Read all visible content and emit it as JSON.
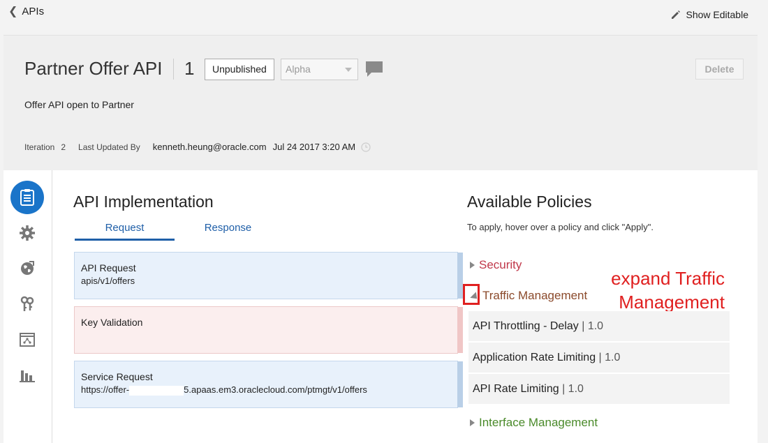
{
  "nav": {
    "back_label": "APIs",
    "show_editable_label": "Show Editable"
  },
  "api": {
    "title": "Partner Offer API",
    "version": "1",
    "state_label": "Unpublished",
    "stage_value": "Alpha",
    "delete_label": "Delete",
    "description": "Offer API open to Partner",
    "iteration_label": "Iteration",
    "iteration_value": "2",
    "last_updated_label": "Last Updated By",
    "last_updated_user": "kenneth.heung@oracle.com",
    "last_updated_date": "Jul 24 2017 3:20 AM"
  },
  "sidebar": {
    "items": [
      {
        "icon": "clipboard-icon",
        "active": true
      },
      {
        "icon": "gear-icon",
        "active": false
      },
      {
        "icon": "globe-icon",
        "active": false
      },
      {
        "icon": "keys-icon",
        "active": false
      },
      {
        "icon": "gateway-icon",
        "active": false
      },
      {
        "icon": "bar-chart-icon",
        "active": false
      }
    ]
  },
  "implementation": {
    "heading": "API Implementation",
    "tabs": [
      {
        "label": "Request",
        "active": true
      },
      {
        "label": "Response",
        "active": false
      }
    ],
    "cards": [
      {
        "title": "API Request",
        "detail": "apis/v1/offers"
      },
      {
        "title": "Key Validation",
        "detail": ""
      },
      {
        "title": "Service Request",
        "detail_prefix": "https://offer-",
        "detail_suffix": "5.apaas.em3.oraclecloud.com/ptmgt/v1/offers"
      }
    ]
  },
  "policies": {
    "heading": "Available Policies",
    "hint": "To apply, hover over a policy and click \"Apply\".",
    "groups": {
      "security": {
        "label": "Security",
        "color": "#c0384a"
      },
      "traffic": {
        "label": "Traffic Management",
        "color": "#8b4a2b"
      },
      "interface": {
        "label": "Interface Management",
        "color": "#4a8a2a"
      }
    },
    "traffic_items": [
      {
        "name": "API Throttling - Delay",
        "version": "1.0"
      },
      {
        "name": "Application Rate Limiting",
        "version": "1.0"
      },
      {
        "name": "API Rate Limiting",
        "version": "1.0"
      }
    ],
    "version_separator": "|"
  },
  "annotation": {
    "line1": "expand Traffic",
    "line2": "Management",
    "color": "#e02020"
  },
  "colors": {
    "accent": "#1a74c9",
    "tab": "#1f5fa8"
  }
}
